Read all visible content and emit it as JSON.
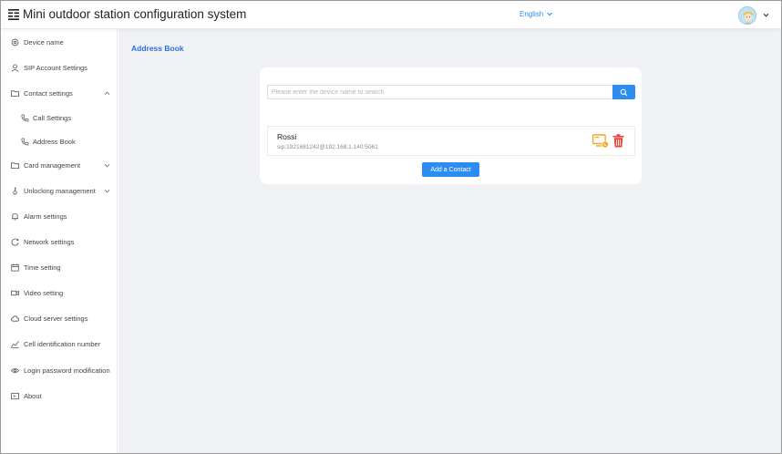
{
  "header": {
    "title": "Mini outdoor station configuration system",
    "language": "English",
    "menu_icon": "menu-icon",
    "avatar_icon": "user-avatar",
    "accent_color": "#2d8cf0"
  },
  "sidebar": {
    "items": [
      {
        "label": "Device name",
        "icon": "settings-icon"
      },
      {
        "label": "SIP Account Settings",
        "icon": "user-icon"
      },
      {
        "label": "Contact settings",
        "icon": "folder-icon",
        "expanded": true
      },
      {
        "label": "Call Settings",
        "icon": "phone-icon"
      },
      {
        "label": "Address Book",
        "icon": "phone-book-icon",
        "selected": true
      },
      {
        "label": "Card management",
        "icon": "folder-icon",
        "expanded": false
      },
      {
        "label": "Unlocking management",
        "icon": "key-icon",
        "expanded": false
      },
      {
        "label": "Alarm settings",
        "icon": "bell-icon"
      },
      {
        "label": "Network settings",
        "icon": "network-icon"
      },
      {
        "label": "Time setting",
        "icon": "calendar-icon"
      },
      {
        "label": "Video setting",
        "icon": "video-icon"
      },
      {
        "label": "Cloud server settings",
        "icon": "cloud-icon"
      },
      {
        "label": "Cell identification number",
        "icon": "chart-icon"
      },
      {
        "label": "Login password modification",
        "icon": "eye-icon"
      },
      {
        "label": "About",
        "icon": "about-icon"
      }
    ]
  },
  "main": {
    "page_title": "Address Book",
    "search": {
      "placeholder": "Please enter the device name to search",
      "value": ""
    },
    "contacts": [
      {
        "name": "Rossi",
        "sip": "sip:1921681242@192.168.1.140:5061"
      }
    ],
    "add_button": "Add a Contact",
    "monitor_color": "#f5a623",
    "delete_color": "#e8443a"
  }
}
